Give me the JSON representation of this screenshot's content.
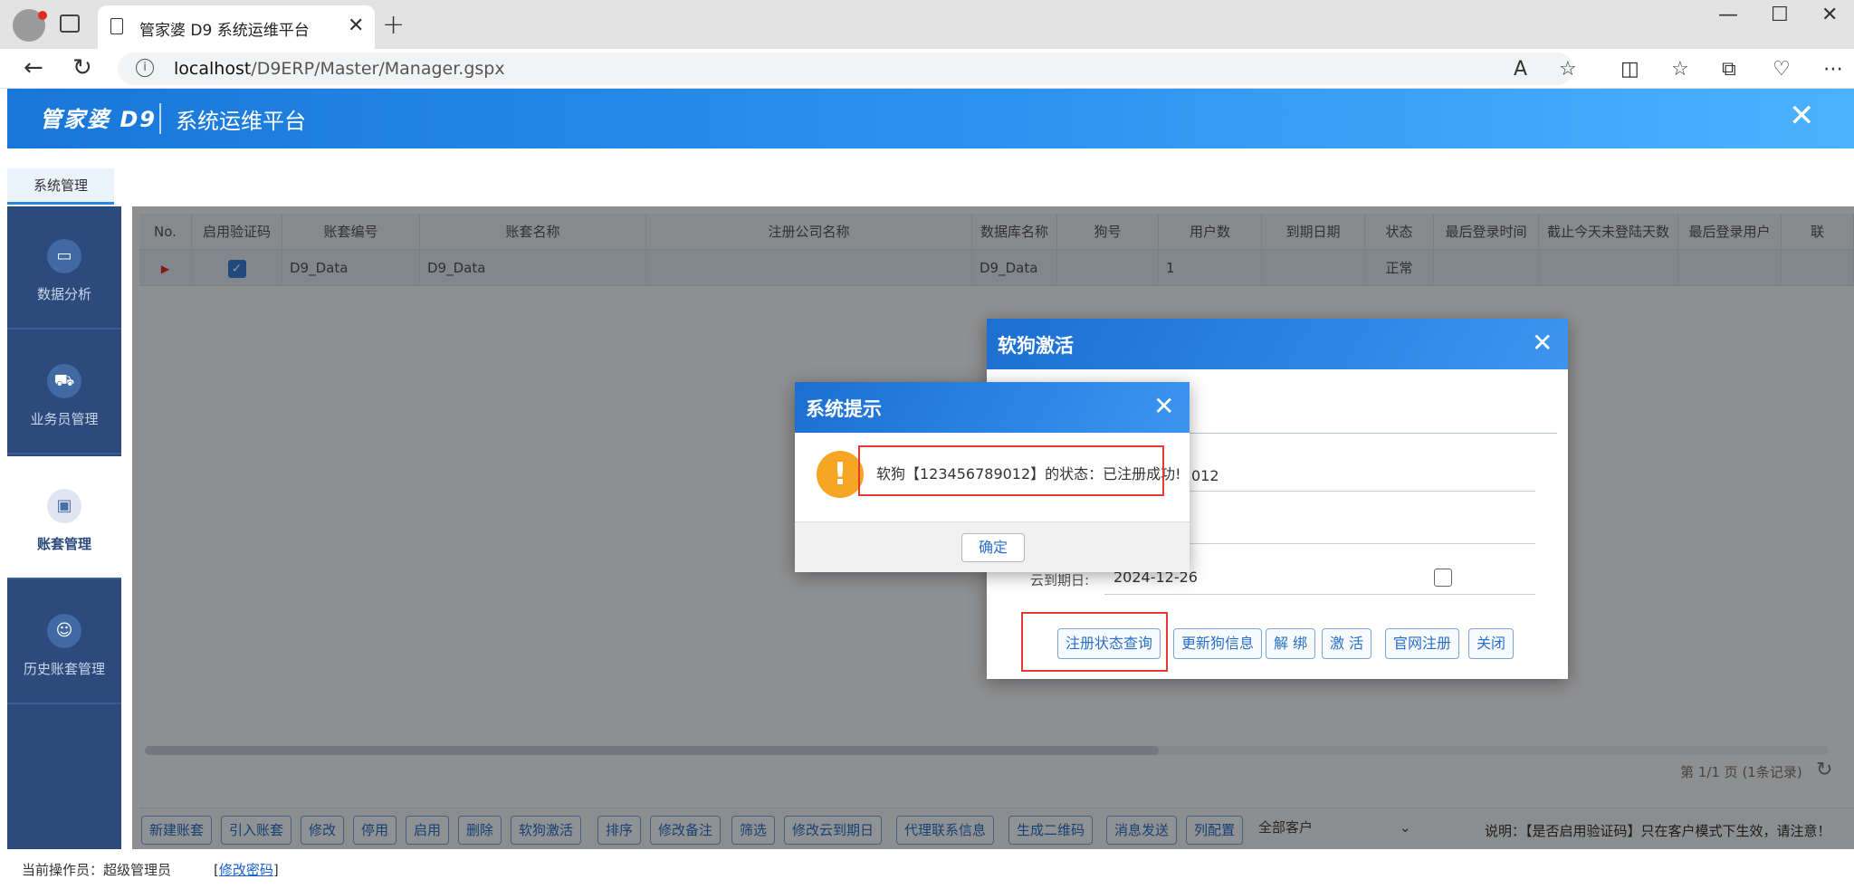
{
  "browser": {
    "tab_title": "管家婆 D9 系统运维平台",
    "url_host": "localhost",
    "url_path": "/D9ERP/Master/Manager.gspx"
  },
  "app": {
    "logo": "管家婆 D9",
    "platform_title": "系统运维平台",
    "menu_tab": "系统管理"
  },
  "sidebar": {
    "items": [
      {
        "label": "数据分析",
        "icon": "chart-icon"
      },
      {
        "label": "业务员管理",
        "icon": "cart-icon"
      },
      {
        "label": "账套管理",
        "icon": "briefcase-icon"
      },
      {
        "label": "历史账套管理",
        "icon": "user-gear-icon"
      }
    ],
    "active_index": 2
  },
  "grid": {
    "columns": [
      "No.",
      "启用验证码",
      "账套编号",
      "账套名称",
      "注册公司名称",
      "数据库名称",
      "狗号",
      "用户数",
      "到期日期",
      "状态",
      "最后登录时间",
      "截止今天未登陆天数",
      "最后登录用户",
      "联"
    ],
    "rows": [
      {
        "no": "",
        "verify_enabled": true,
        "code": "D9_Data",
        "name": "D9_Data",
        "company": "",
        "db": "D9_Data",
        "dog": "",
        "users": "1",
        "expire": "",
        "status": "正常",
        "last_login": "",
        "days": "",
        "last_user": ""
      }
    ],
    "pager": "第 1/1 页 (1条记录)"
  },
  "toolbar": {
    "buttons": [
      "新建账套",
      "引入账套",
      "修改",
      "停用",
      "启用",
      "删除",
      "软狗激活",
      "排序",
      "修改备注",
      "筛选",
      "修改云到期日",
      "代理联系信息",
      "生成二维码",
      "消息发送",
      "列配置"
    ],
    "select_value": "全部客户",
    "note": "说明：【是否启用验证码】只在客户模式下生效，请注意！"
  },
  "status": {
    "operator": "当前操作员：超级管理员",
    "change_pwd": "修改密码"
  },
  "dialog_activate": {
    "title": "软狗激活",
    "dog_value_partial": "012",
    "cloud_expire_label": "云到期日:",
    "cloud_expire_value": "2024-12-26",
    "buttons": [
      "注册状态查询",
      "更新狗信息",
      "解 绑",
      "激 活",
      "官网注册",
      "关闭"
    ]
  },
  "dialog_tip": {
    "title": "系统提示",
    "message": "软狗【123456789012】的状态：已注册成功!",
    "ok": "确定"
  },
  "colors": {
    "header_blue": "#1877d9",
    "sidebar_navy": "#2c4a7c",
    "highlight_red": "#e53935",
    "warning_orange": "#f5a623"
  }
}
